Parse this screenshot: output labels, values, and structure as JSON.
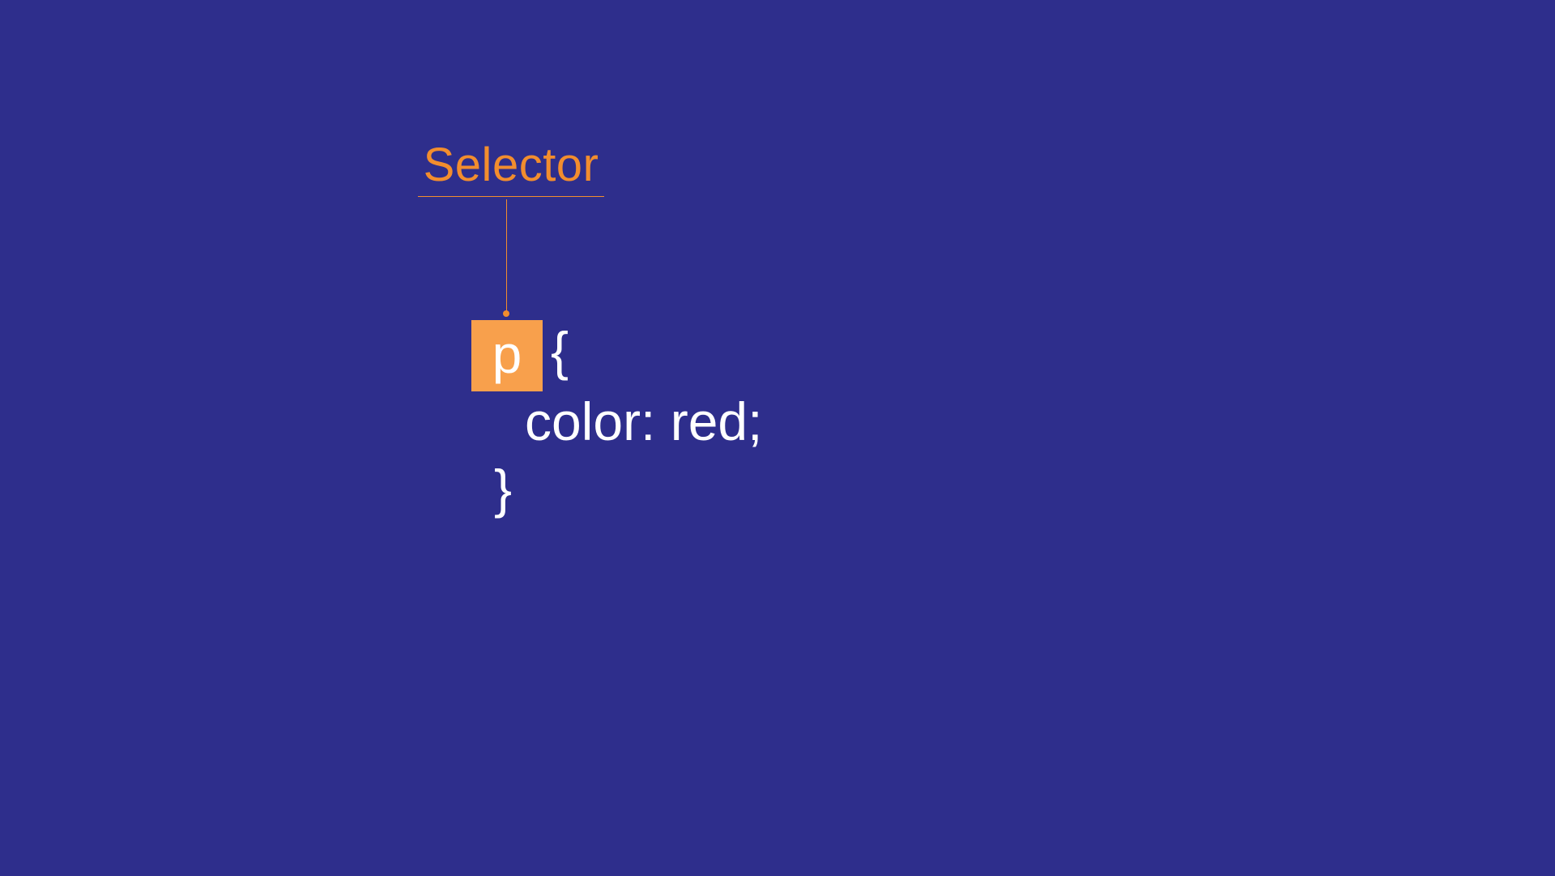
{
  "annotation": {
    "label": "Selector"
  },
  "css_rule": {
    "selector": "p",
    "open_brace": "{",
    "declaration": "color: red;",
    "close_brace": "}"
  },
  "colors": {
    "background": "#2e2e8c",
    "accent": "#f28d2e",
    "highlight": "#f8a04c",
    "text": "#ffffff"
  }
}
